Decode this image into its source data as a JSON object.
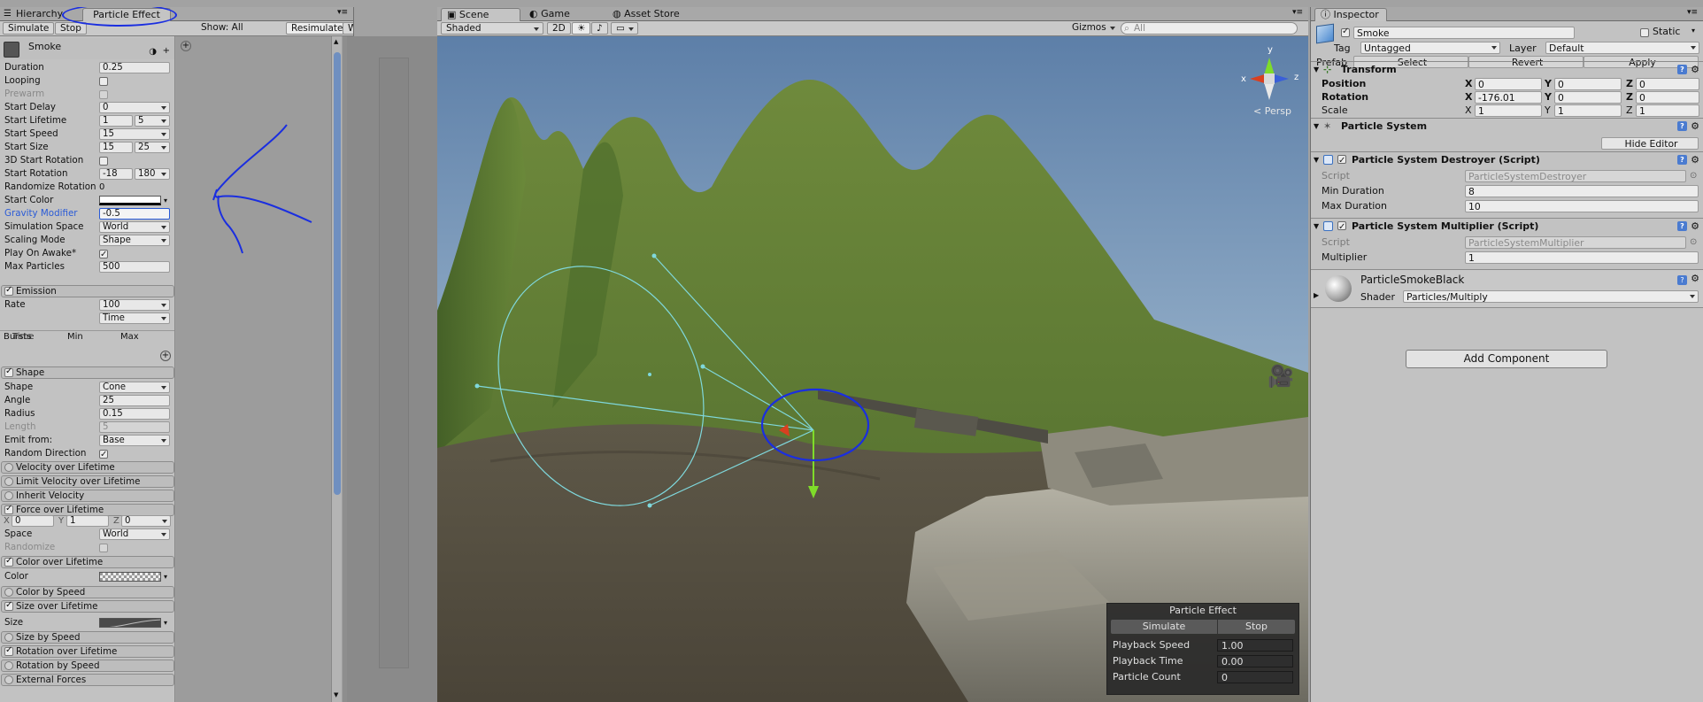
{
  "left_panel": {
    "tabs": [
      "Hierarchy",
      "Particle Effect"
    ],
    "toolbar": {
      "simulate": "Simulate",
      "stop": "Stop",
      "show_all": "Show: All",
      "resimulate": "Resimulate",
      "wireframe": "Wireframe"
    },
    "system_name": "Smoke",
    "main_props": [
      {
        "label": "Duration",
        "value": "0.25",
        "kind": "field"
      },
      {
        "label": "Looping",
        "kind": "check",
        "checked": false
      },
      {
        "label": "Prewarm",
        "kind": "check",
        "checked": false,
        "disabled": true
      },
      {
        "label": "Start Delay",
        "value": "0",
        "kind": "dropdown"
      },
      {
        "label": "Start Lifetime",
        "value": "1",
        "value2": "5",
        "kind": "range"
      },
      {
        "label": "Start Speed",
        "value": "15",
        "kind": "dropdown"
      },
      {
        "label": "Start Size",
        "value": "15",
        "value2": "25",
        "kind": "range"
      },
      {
        "label": "3D Start Rotation",
        "kind": "check",
        "checked": false
      },
      {
        "label": "Start Rotation",
        "value": "-18",
        "value2": "180",
        "kind": "range"
      },
      {
        "label": "Randomize Rotation",
        "value": "0",
        "kind": "plain"
      },
      {
        "label": "Start Color",
        "kind": "color"
      },
      {
        "label": "Gravity Modifier",
        "value": "-0.5",
        "kind": "field",
        "highlight": true
      },
      {
        "label": "Simulation Space",
        "value": "World",
        "kind": "select"
      },
      {
        "label": "Scaling Mode",
        "value": "Shape",
        "kind": "select"
      },
      {
        "label": "Play On Awake*",
        "kind": "check",
        "checked": true
      },
      {
        "label": "Max Particles",
        "value": "500",
        "kind": "field"
      }
    ],
    "emission": {
      "title": "Emission",
      "rate_label": "Rate",
      "rate_value": "100",
      "rate_unit": "Time",
      "bursts_header": [
        "Bursts",
        "Time",
        "Min",
        "Max"
      ]
    },
    "shape": {
      "title": "Shape",
      "props": [
        {
          "label": "Shape",
          "value": "Cone"
        },
        {
          "label": "Angle",
          "value": "25"
        },
        {
          "label": "Radius",
          "value": "0.15"
        },
        {
          "label": "Length",
          "value": "5"
        },
        {
          "label": "Emit from:",
          "value": "Base"
        },
        {
          "label": "Random Direction",
          "value": ""
        }
      ]
    },
    "modules": [
      {
        "label": "Velocity over Lifetime",
        "on": false
      },
      {
        "label": "Limit Velocity over Lifetime",
        "on": false
      },
      {
        "label": "Inherit Velocity",
        "on": false
      },
      {
        "label": "Force over Lifetime",
        "on": true
      }
    ],
    "force": {
      "x_label": "X",
      "x": "0",
      "y_label": "Y",
      "y": "1",
      "z_label": "Z",
      "z": "0",
      "space_label": "Space",
      "space": "World",
      "randomize_label": "Randomize"
    },
    "color_over_lifetime": {
      "title": "Color over Lifetime",
      "color_label": "Color"
    },
    "color_by_speed": "Color by Speed",
    "size_over_lifetime": {
      "title": "Size over Lifetime",
      "size_label": "Size"
    },
    "modules2": [
      {
        "label": "Size by Speed",
        "on": false
      },
      {
        "label": "Rotation over Lifetime",
        "on": true
      },
      {
        "label": "Rotation by Speed",
        "on": false
      },
      {
        "label": "External Forces",
        "on": false
      }
    ]
  },
  "scene": {
    "tabs": [
      "Scene",
      "Game",
      "Asset Store"
    ],
    "toolbar": {
      "shaded": "Shaded",
      "mode_2d": "2D",
      "gizmos": "Gizmos",
      "search_placeholder": "All"
    },
    "persp": "Persp",
    "overlay": {
      "title": "Particle Effect",
      "simulate": "Simulate",
      "stop": "Stop",
      "rows": [
        {
          "label": "Playback Speed",
          "value": "1.00"
        },
        {
          "label": "Playback Time",
          "value": "0.00"
        },
        {
          "label": "Particle Count",
          "value": "0"
        }
      ]
    },
    "axes": {
      "x": "x",
      "y": "y",
      "z": "z"
    }
  },
  "inspector": {
    "tab": "Inspector",
    "name": "Smoke",
    "static_label": "Static",
    "tag_label": "Tag",
    "tag": "Untagged",
    "layer_label": "Layer",
    "layer": "Default",
    "prefab_label": "Prefab",
    "prefab_buttons": [
      "Select",
      "Revert",
      "Apply"
    ],
    "transform": {
      "title": "Transform",
      "rows": [
        {
          "label": "Position",
          "x": "0",
          "y": "0",
          "z": "0"
        },
        {
          "label": "Rotation",
          "x": "-176.01",
          "y": "0",
          "z": "0"
        },
        {
          "label": "Scale",
          "x": "1",
          "y": "1",
          "z": "1"
        }
      ]
    },
    "particle_system": {
      "title": "Particle System",
      "hide_editor": "Hide Editor"
    },
    "destroyer": {
      "title": "Particle System Destroyer (Script)",
      "script_label": "Script",
      "script": "ParticleSystemDestroyer",
      "min_label": "Min Duration",
      "min": "8",
      "max_label": "Max Duration",
      "max": "10"
    },
    "multiplier": {
      "title": "Particle System Multiplier (Script)",
      "script_label": "Script",
      "script": "ParticleSystemMultiplier",
      "mult_label": "Multiplier",
      "mult": "1"
    },
    "material": {
      "name": "ParticleSmokeBlack",
      "shader_label": "Shader",
      "shader": "Particles/Multiply"
    },
    "add_component": "Add Component"
  },
  "colors": {
    "accent": "#2a5bd7",
    "annotation": "#1a2ee0"
  }
}
